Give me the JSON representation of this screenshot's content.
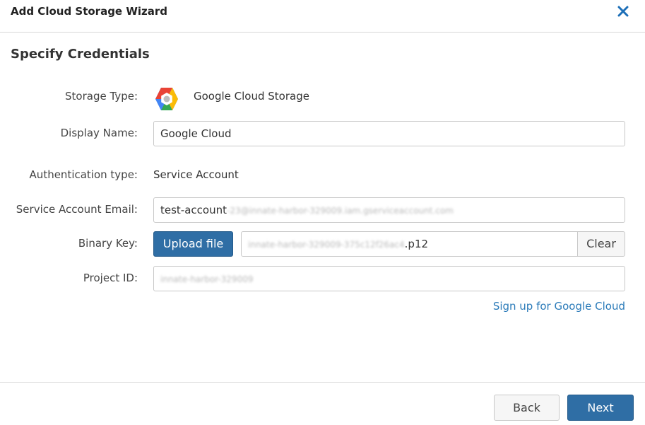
{
  "dialog": {
    "title": "Add Cloud Storage Wizard",
    "close_icon": "close-icon"
  },
  "section_title": "Specify Credentials",
  "form": {
    "storage_type": {
      "label": "Storage Type:",
      "value": "Google Cloud Storage",
      "icon": "google-cloud-storage-icon"
    },
    "display_name": {
      "label": "Display Name:",
      "value": "Google Cloud"
    },
    "auth_type": {
      "label": "Authentication type:",
      "value": "Service Account"
    },
    "service_account_email": {
      "label": "Service Account Email:",
      "value_visible": "test-account",
      "value_blurred": "-23@innate-harbor-329009.iam.gserviceaccount.com"
    },
    "binary_key": {
      "label": "Binary Key:",
      "upload_label": "Upload file",
      "file_blurred": "innate-harbor-329009-375c12f26ac4",
      "file_ext": ".p12",
      "clear_label": "Clear"
    },
    "project_id": {
      "label": "Project ID:",
      "value_blurred": "innate-harbor-329009"
    },
    "signup_link": "Sign up for Google Cloud"
  },
  "footer": {
    "back_label": "Back",
    "next_label": "Next"
  },
  "colors": {
    "primary": "#2f6ea5",
    "link": "#2b7bb9",
    "close": "#1d6fb8"
  }
}
